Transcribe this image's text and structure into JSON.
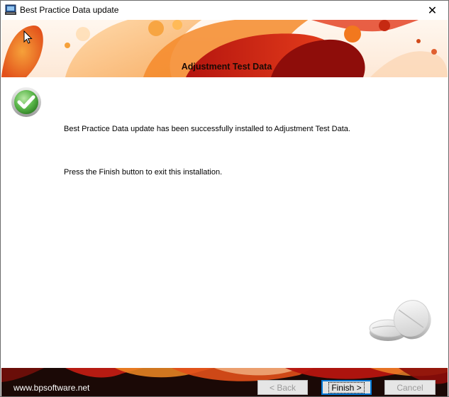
{
  "window": {
    "title": "Best Practice Data update",
    "close_glyph": "✕"
  },
  "banner": {
    "title": "Adjustment Test Data"
  },
  "content": {
    "message_installed": "Best Practice Data update has been successfully installed to Adjustment Test Data.",
    "message_finish": "Press the Finish button to exit this installation."
  },
  "footer": {
    "website": "www.bpsoftware.net",
    "back_label": "< Back",
    "finish_label": "Finish >",
    "cancel_label": "Cancel"
  },
  "icons": {
    "app": "installer-app-icon",
    "close": "close-icon",
    "success": "checkmark-icon",
    "illustration": "pills-icon",
    "cursor": "mouse-cursor-icon"
  },
  "colors": {
    "accent_red": "#c81e14",
    "accent_orange": "#f08a24",
    "footer_bg": "#1b0906",
    "focus_border": "#0078d7",
    "success_green": "#4caf3d"
  }
}
